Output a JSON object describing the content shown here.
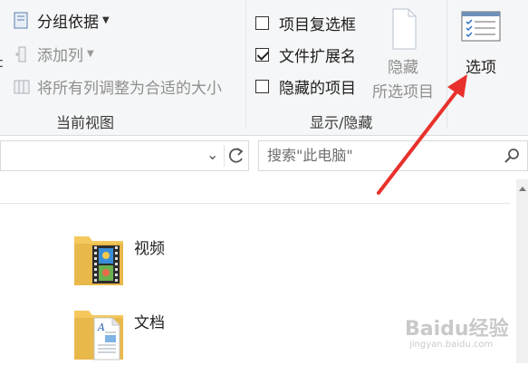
{
  "ribbon": {
    "current_view": {
      "group_label": "当前视图",
      "group_by_label": "分组依据",
      "add_column_label": "添加列",
      "fit_columns_label": "将所有列调整为合适的大小"
    },
    "show_hide": {
      "group_label": "显示/隐藏",
      "item_checkboxes_label": "项目复选框",
      "item_checkboxes_checked": false,
      "file_extensions_label": "文件扩展名",
      "file_extensions_checked": true,
      "hidden_items_label": "隐藏的项目",
      "hidden_items_checked": false,
      "hide_selected_line1": "隐藏",
      "hide_selected_line2": "所选项目"
    },
    "options_label": "选项"
  },
  "left_edge_char": "c",
  "search": {
    "placeholder": "搜索\"此电脑\""
  },
  "folders": [
    {
      "label": "视频",
      "icon": "video-folder-icon"
    },
    {
      "label": "文档",
      "icon": "documents-folder-icon"
    }
  ],
  "watermark": {
    "main": "Baidu经验",
    "sub": "jingyan.baidu.com"
  },
  "colors": {
    "arrow": "#e8312c",
    "ribbon_bg": "#f5f6f7",
    "folder": "#f4c85d"
  }
}
